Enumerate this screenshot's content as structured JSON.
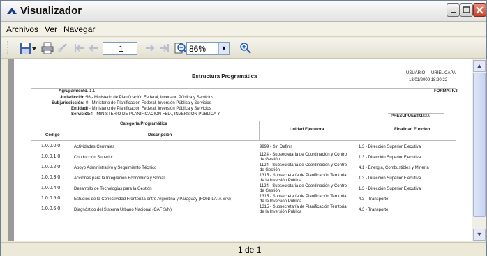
{
  "window": {
    "title": "Visualizador"
  },
  "menu": {
    "items": [
      {
        "label": "Archivos"
      },
      {
        "label": "Ver"
      },
      {
        "label": "Navegar"
      }
    ]
  },
  "toolbar": {
    "page_value": "1",
    "zoom_value": "86%"
  },
  "report": {
    "title": "Estructura Programática",
    "usuario_label": "USUARIO",
    "usuario_value": "URIEL CAPA",
    "datetime": "13/01/2009 18:20:22",
    "form": "FORMA: F.3",
    "agrupamiento_label": "Agrupamiento",
    "agrupamiento_value": "1.1.1",
    "jurisdiccion_label": "Jurisdicción:",
    "jurisdiccion_value": "56 - Ministerio de Planificación Federal, Inversión Pública y Servicios",
    "subjurisdiccion_label": "Subjurisdicción:",
    "subjurisdiccion_value": "0 - Ministerio de Planificación Federal, Inversión Pública y Servicios",
    "entidad_label": "Entidad:",
    "entidad_value": "0 - Ministerio de Planificación Federal, Inversión Pública y Servicios",
    "servicio_label": "Servicio:",
    "servicio_value": "354 - MINISTERIO DE PLANIFICACION FED., INVERSION PUBLICA Y",
    "presupuesto_label": "PRESUPUESTO",
    "presupuesto_value": "2009",
    "headers": {
      "categoria": "Categoría Programática",
      "codigo": "Código",
      "descripcion": "Descripción",
      "unidad": "Unidad Ejecutora",
      "finalidad": "Finalidad Funcion"
    },
    "rows": [
      {
        "codigo": "1.0.0.0.0",
        "descripcion": "Actividades Centrales",
        "unidad1": "9999 - Sin Definir",
        "unidad2": "",
        "finalidad": "1.3 - Dirección Superior Ejecutiva"
      },
      {
        "codigo": "1.0.0.1.0",
        "descripcion": "Conducción Superior",
        "unidad1": "1124 - Subsecretaria de Coordinación y Control",
        "unidad2": "de Gestión",
        "finalidad": "1.3 - Dirección Superior Ejecutiva"
      },
      {
        "codigo": "1.0.0.2.0",
        "descripcion": "Apoyo Administrativo y Seguimiento Técnico",
        "unidad1": "1124 - Subsecretaria de Coordinación y Control",
        "unidad2": "de Gestión",
        "finalidad": "4.1 - Energía, Combustibles y Minería"
      },
      {
        "codigo": "1.0.0.3.0",
        "descripcion": "Acciones para la Integración Económica y Social",
        "unidad1": "1315 - Subsecretaría de Planificación Territorial",
        "unidad2": "de la Inversión Pública",
        "finalidad": "1.3 - Dirección Superior Ejecutiva"
      },
      {
        "codigo": "1.0.0.4.0",
        "descripcion": "Desarrollo de Tecnologías para la Gestión",
        "unidad1": "1124 - Subsecretaria de Coordinación y Control",
        "unidad2": "de Gestión",
        "finalidad": "1.3 - Dirección Superior Ejecutiva"
      },
      {
        "codigo": "1.0.0.5.0",
        "descripcion": "Estudios de la Conectividad Fronteriza entre Argentina y Paraguay (FONPLATA S/N)",
        "unidad1": "1315 - Subsecretaría de Planificación Territorial",
        "unidad2": "de la Inversión Pública",
        "finalidad": "4.3 - Transporte"
      },
      {
        "codigo": "1.0.0.6.0",
        "descripcion": "Diagnóstico del Sistema Urbano Nacional (CAF S/N)",
        "unidad1": "1315 - Subsecretaría de Planificación Territorial",
        "unidad2": "de la Inversión Pública",
        "finalidad": "4.3 - Transporte"
      }
    ]
  },
  "status": {
    "text": "1 de 1"
  }
}
